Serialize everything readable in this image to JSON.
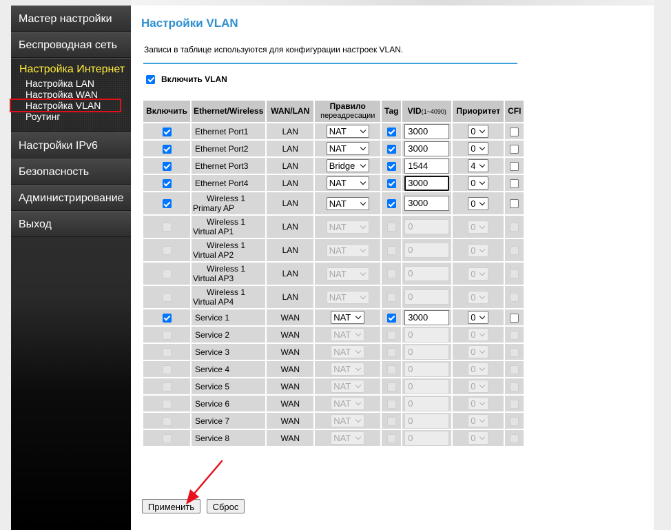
{
  "sidebar": {
    "top_items": [
      "Мастер настройки",
      "Беспроводная сеть"
    ],
    "group_title": "Настройка Интернет",
    "sub_items": [
      "Настройка LAN",
      "Настройка WAN",
      "Настройка VLAN",
      "Роутинг"
    ],
    "bottom_items": [
      "Настройки IPv6",
      "Безопасность",
      "Администрирование",
      "Выход"
    ]
  },
  "page": {
    "title": "Настройки VLAN",
    "description": "Записи в таблице используются для конфигурации настроек VLAN.",
    "enable_vlan_label": "Включить VLAN",
    "enable_vlan_checked": true
  },
  "table": {
    "headers": {
      "enable": "Включить",
      "port": "Ethernet/Wireless",
      "wanlan": "WAN/LAN",
      "rule_line1": "Правило",
      "rule_line2": "переадресации",
      "tag": "Tag",
      "vid": "VID",
      "vid_range": "(1~4090)",
      "priority": "Приоритет",
      "cfi": "CFI"
    },
    "rows": [
      {
        "line1": "Ethernet Port1",
        "line2": "",
        "type": "LAN",
        "rule": "NAT",
        "vid": "3000",
        "priority": "0",
        "enabled": true,
        "tag": true,
        "cfi": false
      },
      {
        "line1": "Ethernet Port2",
        "line2": "",
        "type": "LAN",
        "rule": "NAT",
        "vid": "3000",
        "priority": "0",
        "enabled": true,
        "tag": true,
        "cfi": false
      },
      {
        "line1": "Ethernet Port3",
        "line2": "",
        "type": "LAN",
        "rule": "Bridge",
        "vid": "1544",
        "priority": "4",
        "enabled": true,
        "tag": true,
        "cfi": false
      },
      {
        "line1": "Ethernet Port4",
        "line2": "",
        "type": "LAN",
        "rule": "NAT",
        "vid": "3000",
        "priority": "0",
        "enabled": true,
        "tag": true,
        "cfi": false
      },
      {
        "line1": "Wireless 1",
        "line2": "Primary AP",
        "type": "LAN",
        "rule": "NAT",
        "vid": "3000",
        "priority": "0",
        "enabled": true,
        "tag": true,
        "cfi": false
      },
      {
        "line1": "Wireless 1",
        "line2": "Virtual AP1",
        "type": "LAN",
        "rule": "NAT",
        "vid": "0",
        "priority": "0",
        "enabled": false,
        "tag": false,
        "cfi": false
      },
      {
        "line1": "Wireless 1",
        "line2": "Virtual AP2",
        "type": "LAN",
        "rule": "NAT",
        "vid": "0",
        "priority": "0",
        "enabled": false,
        "tag": false,
        "cfi": false
      },
      {
        "line1": "Wireless 1",
        "line2": "Virtual AP3",
        "type": "LAN",
        "rule": "NAT",
        "vid": "0",
        "priority": "0",
        "enabled": false,
        "tag": false,
        "cfi": false
      },
      {
        "line1": "Wireless 1",
        "line2": "Virtual AP4",
        "type": "LAN",
        "rule": "NAT",
        "vid": "0",
        "priority": "0",
        "enabled": false,
        "tag": false,
        "cfi": false
      },
      {
        "line1": "Service 1",
        "line2": "",
        "type": "WAN",
        "rule": "NAT",
        "vid": "3000",
        "priority": "0",
        "enabled": true,
        "tag": true,
        "cfi": false
      },
      {
        "line1": "Service 2",
        "line2": "",
        "type": "WAN",
        "rule": "NAT",
        "vid": "0",
        "priority": "0",
        "enabled": false,
        "tag": false,
        "cfi": false
      },
      {
        "line1": "Service 3",
        "line2": "",
        "type": "WAN",
        "rule": "NAT",
        "vid": "0",
        "priority": "0",
        "enabled": false,
        "tag": false,
        "cfi": false
      },
      {
        "line1": "Service 4",
        "line2": "",
        "type": "WAN",
        "rule": "NAT",
        "vid": "0",
        "priority": "0",
        "enabled": false,
        "tag": false,
        "cfi": false
      },
      {
        "line1": "Service 5",
        "line2": "",
        "type": "WAN",
        "rule": "NAT",
        "vid": "0",
        "priority": "0",
        "enabled": false,
        "tag": false,
        "cfi": false
      },
      {
        "line1": "Service 6",
        "line2": "",
        "type": "WAN",
        "rule": "NAT",
        "vid": "0",
        "priority": "0",
        "enabled": false,
        "tag": false,
        "cfi": false
      },
      {
        "line1": "Service 7",
        "line2": "",
        "type": "WAN",
        "rule": "NAT",
        "vid": "0",
        "priority": "0",
        "enabled": false,
        "tag": false,
        "cfi": false
      },
      {
        "line1": "Service 8",
        "line2": "",
        "type": "WAN",
        "rule": "NAT",
        "vid": "0",
        "priority": "0",
        "enabled": false,
        "tag": false,
        "cfi": false
      }
    ]
  },
  "buttons": {
    "apply": "Применить",
    "reset": "Сброс"
  },
  "colors": {
    "title_blue": "#2f8fd1",
    "group_title_yellow": "#ffeb3b",
    "highlight_red": "#e0101a",
    "arrow_red": "#e8101c",
    "checkbox_blue": "#0075ff"
  },
  "icons": {
    "annotation_arrow": "red-arrow-icon",
    "select_arrow": "chevron-down-icon"
  }
}
